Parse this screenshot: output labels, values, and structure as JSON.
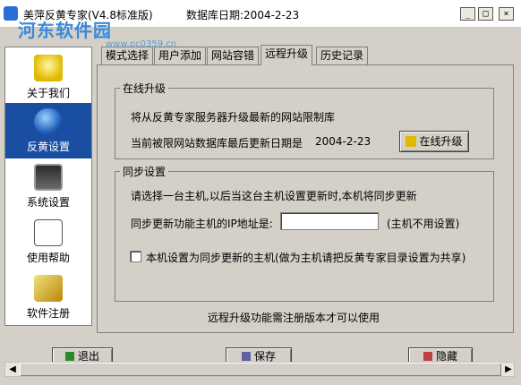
{
  "window": {
    "title": "美萍反黄专家(V4.8标准版)",
    "db_date_label": "数据库日期:2004-2-23",
    "minimize_glyph": "_",
    "maximize_glyph": "□",
    "close_glyph": "×"
  },
  "watermark": {
    "site": "河东软件园",
    "url": "www.pc0359.cn"
  },
  "sidebar": {
    "items": [
      {
        "label": "关于我们",
        "icon": "info-bulb-icon"
      },
      {
        "label": "反黄设置",
        "icon": "globe-icon"
      },
      {
        "label": "系统设置",
        "icon": "computer-icon"
      },
      {
        "label": "使用帮助",
        "icon": "help-document-icon"
      },
      {
        "label": "软件注册",
        "icon": "register-pen-icon"
      }
    ],
    "active_index": 1
  },
  "tabs": [
    "模式选择",
    "用户添加",
    "网站容错",
    "远程升级",
    "历史记录"
  ],
  "active_tab": "远程升级",
  "online_upgrade": {
    "title": "在线升级",
    "description": "将从反黄专家服务器升级最新的网站限制库",
    "last_update_label": "当前被限网站数据库最后更新日期是",
    "last_update_date": "2004-2-23",
    "button_label": "在线升级"
  },
  "sync": {
    "title": "同步设置",
    "description": "请选择一台主机,以后当这台主机设置更新时,本机将同步更新",
    "ip_label": "同步更新功能主机的IP地址是:",
    "ip_value": "",
    "ip_hint": "(主机不用设置)",
    "checkbox_label": "本机设置为同步更新的主机(做为主机请把反黄专家目录设置为共享)",
    "checkbox_checked": false
  },
  "footer_note": "远程升级功能需注册版本才可以使用",
  "bottom_buttons": {
    "exit": "退出",
    "save": "保存",
    "hide": "隐藏"
  },
  "scrollbar": {
    "left_glyph": "◀",
    "right_glyph": "▶"
  }
}
